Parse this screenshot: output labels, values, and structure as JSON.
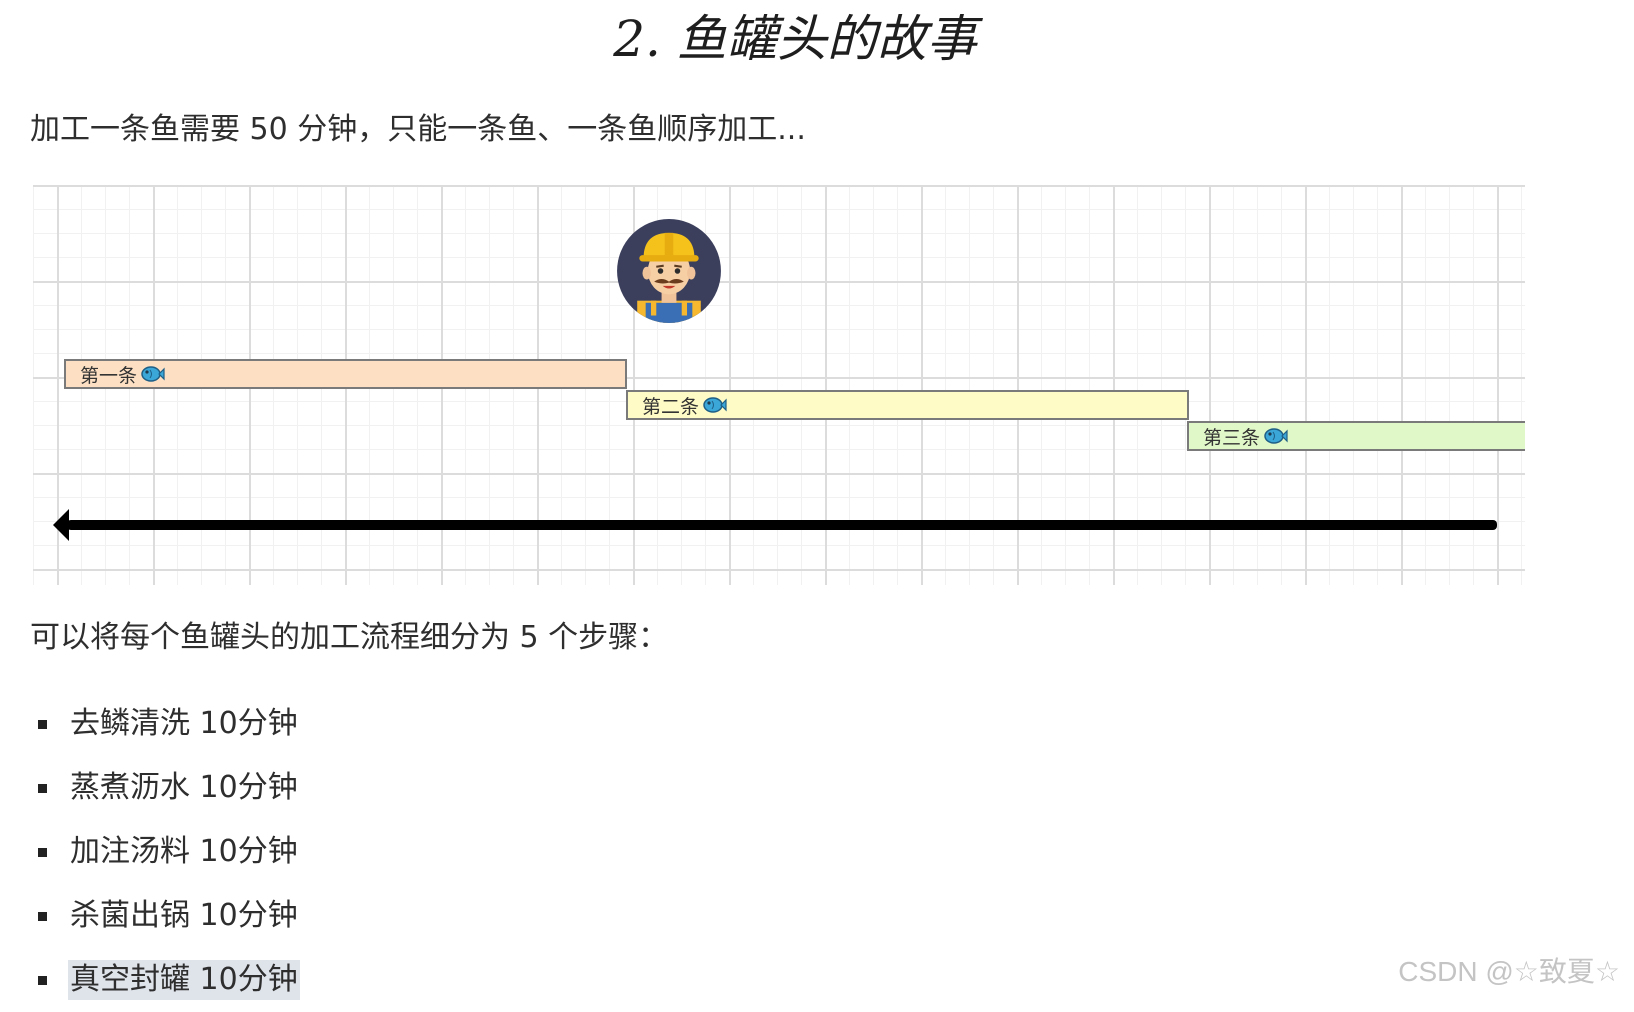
{
  "section_title": "2. 鱼罐头的故事",
  "intro_text": "加工一条鱼需要 50 分钟，只能一条鱼、一条鱼顺序加工...",
  "diagram": {
    "worker_icon": "worker-avatar-icon",
    "fish_icon": "fish-icon",
    "bars": [
      {
        "label": "第一条",
        "color": "#fde0c4"
      },
      {
        "label": "第二条",
        "color": "#fffbc6"
      },
      {
        "label": "第三条",
        "color": "#e0f7c8"
      }
    ]
  },
  "steps_intro": "可以将每个鱼罐头的加工流程细分为 5 个步骤：",
  "steps": [
    "去鳞清洗 10分钟",
    "蒸煮沥水 10分钟",
    "加注汤料 10分钟",
    "杀菌出锅 10分钟",
    "真空封罐 10分钟"
  ],
  "watermark": "CSDN @☆致夏☆"
}
